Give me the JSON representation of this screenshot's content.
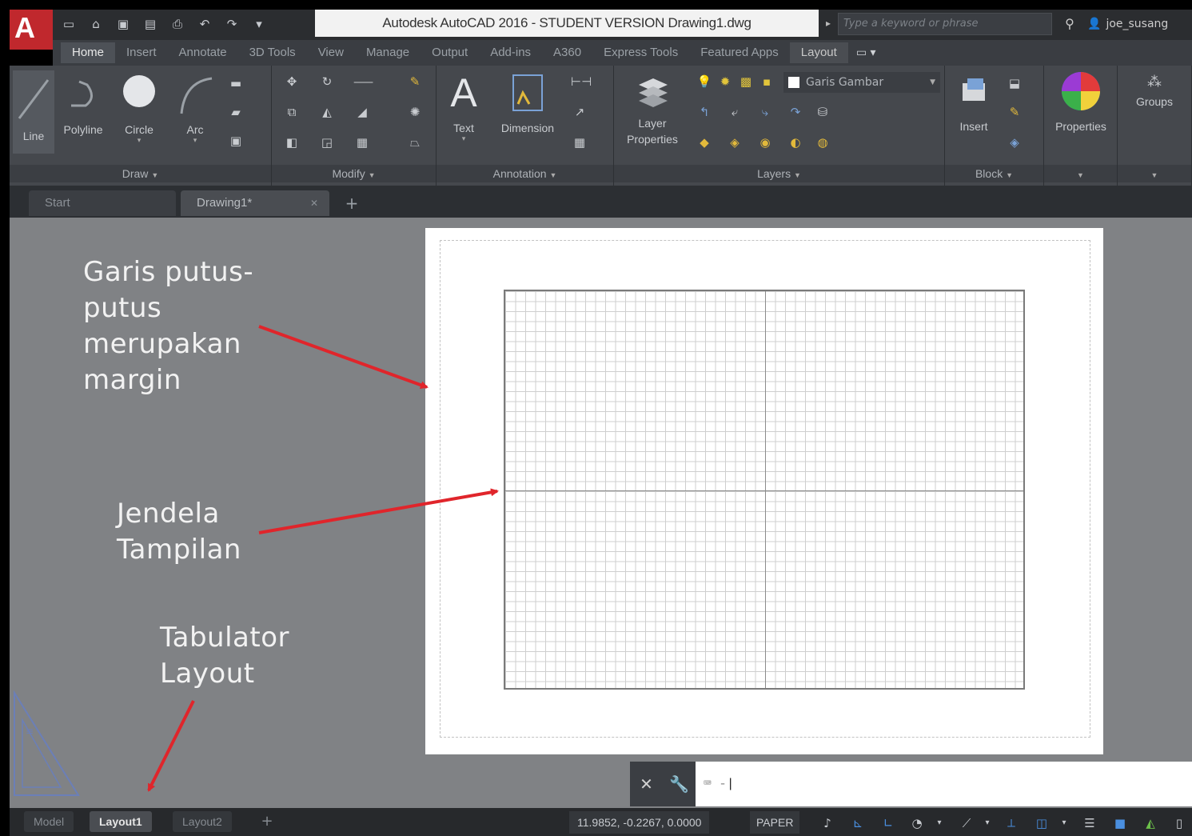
{
  "app": {
    "logo_letter": "A",
    "title": "Autodesk AutoCAD 2016 - STUDENT VERSION    Drawing1.dwg",
    "search_placeholder": "Type a keyword or phrase",
    "user_name": "joe_susang"
  },
  "quick_access": [
    "new-icon",
    "open-icon",
    "save-icon",
    "save-as-icon",
    "plot-icon",
    "undo-icon",
    "redo-icon"
  ],
  "ribbon_tabs": [
    {
      "label": "Home",
      "active": true
    },
    {
      "label": "Insert"
    },
    {
      "label": "Annotate"
    },
    {
      "label": "3D Tools"
    },
    {
      "label": "View"
    },
    {
      "label": "Manage"
    },
    {
      "label": "Output"
    },
    {
      "label": "Add-ins"
    },
    {
      "label": "A360"
    },
    {
      "label": "Express Tools"
    },
    {
      "label": "Featured Apps"
    },
    {
      "label": "Layout",
      "contextual": true
    }
  ],
  "ribbon": {
    "draw": {
      "label": "Draw",
      "line": "Line",
      "polyline": "Polyline",
      "circle": "Circle",
      "arc": "Arc"
    },
    "modify": {
      "label": "Modify"
    },
    "annotation": {
      "label": "Annotation",
      "text": "Text",
      "dimension": "Dimension"
    },
    "layers": {
      "label": "Layers",
      "layer_properties_1": "Layer",
      "layer_properties_2": "Properties",
      "current_layer": "Garis Gambar"
    },
    "block": {
      "label": "Block",
      "insert": "Insert"
    },
    "properties": {
      "label": "Properties"
    },
    "groups": {
      "label": "Groups"
    }
  },
  "file_tabs": [
    {
      "label": "Start"
    },
    {
      "label": "Drawing1*",
      "active": true
    }
  ],
  "annotations": {
    "margin_lines": [
      "Garis putus-",
      "putus",
      "merupakan",
      "margin"
    ],
    "viewport_lines": [
      "Jendela",
      "Tampilan"
    ],
    "layout_lines": [
      "Tabulator",
      "Layout"
    ]
  },
  "command_line": {
    "prompt": "⌨ -"
  },
  "layout_tabs": [
    {
      "label": "Model"
    },
    {
      "label": "Layout1",
      "active": true
    },
    {
      "label": "Layout2"
    }
  ],
  "status": {
    "coordinates": "11.9852, -0.2267, 0.0000",
    "space": "PAPER"
  },
  "colors": {
    "arrow": "#e0252b",
    "workspace": "#808285",
    "ribbon": "#45484d"
  }
}
